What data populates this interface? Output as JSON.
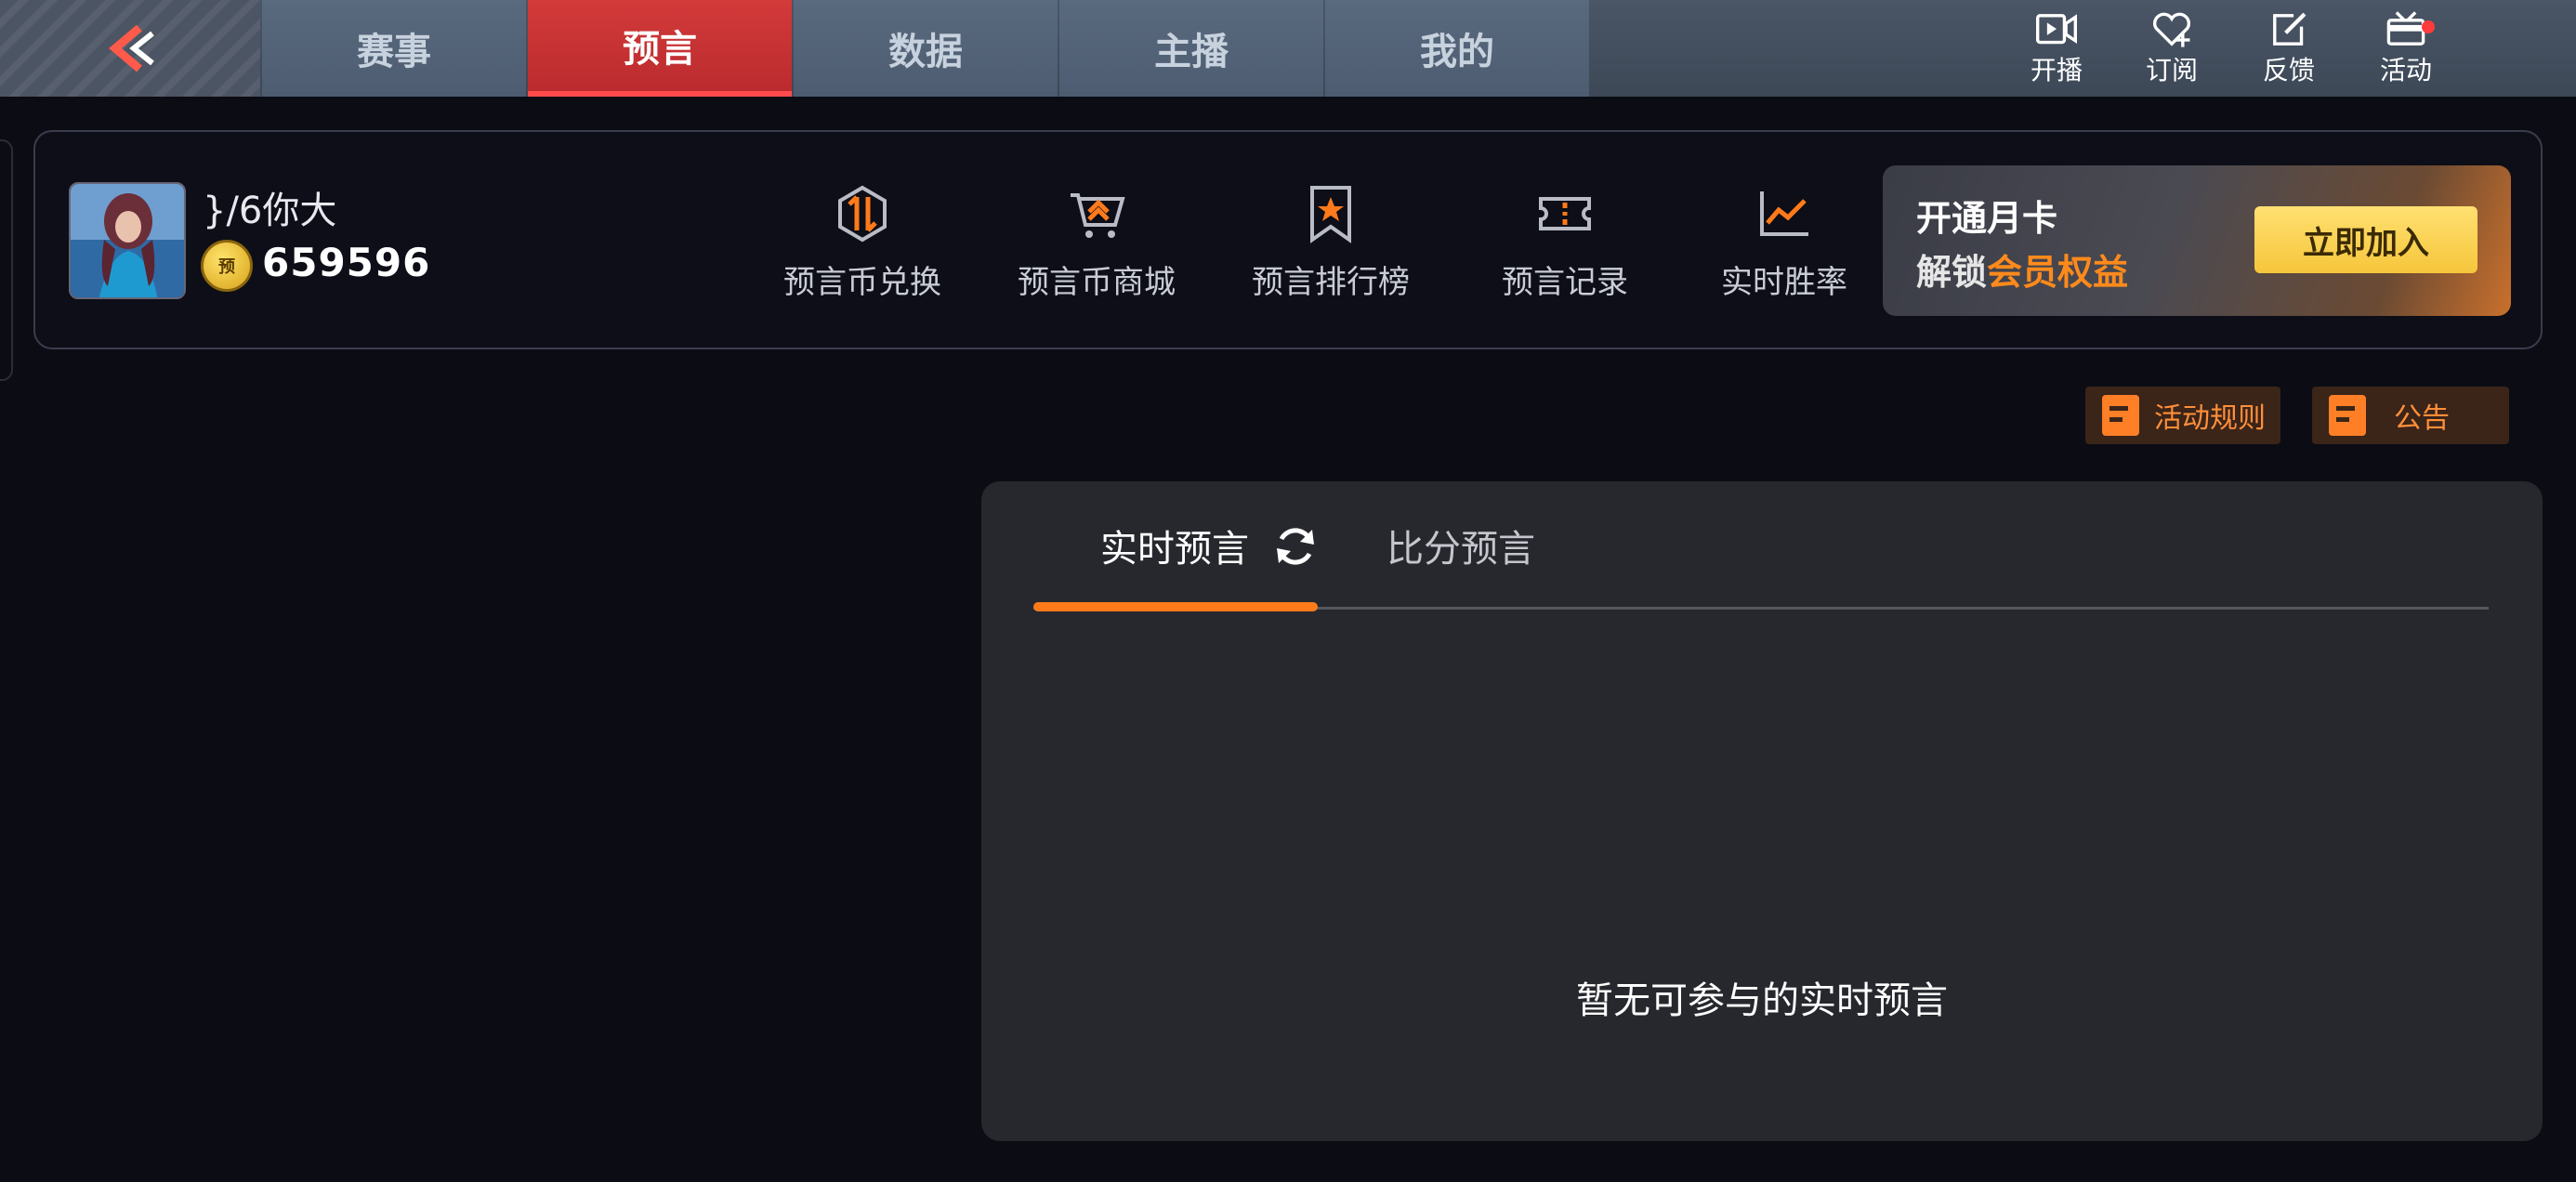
{
  "topbar": {
    "back_icon": "chevron-left-double-icon",
    "tabs": [
      {
        "label": "赛事",
        "active": false
      },
      {
        "label": "预言",
        "active": true
      },
      {
        "label": "数据",
        "active": false
      },
      {
        "label": "主播",
        "active": false
      },
      {
        "label": "我的",
        "active": false
      }
    ],
    "actions": [
      {
        "label": "开播",
        "icon": "video-play-icon"
      },
      {
        "label": "订阅",
        "icon": "heart-plus-icon"
      },
      {
        "label": "反馈",
        "icon": "edit-icon"
      },
      {
        "label": "活动",
        "icon": "tv-icon",
        "badge": true
      }
    ]
  },
  "profile": {
    "username": "}/6你大",
    "coin_badge": "预",
    "coins": "659596"
  },
  "features": [
    {
      "label": "预言币兑换",
      "icon": "exchange-icon"
    },
    {
      "label": "预言币商城",
      "icon": "shopping-cart-icon"
    },
    {
      "label": "预言排行榜",
      "icon": "ranking-bookmark-icon"
    },
    {
      "label": "预言记录",
      "icon": "ticket-icon"
    },
    {
      "label": "实时胜率",
      "icon": "line-chart-icon"
    }
  ],
  "promo": {
    "title": "开通月卡",
    "subtitle_prefix": "解锁",
    "subtitle_highlight": "会员权益",
    "button": "立即加入"
  },
  "mini_buttons": {
    "rules": "活动规则",
    "notice": "公告"
  },
  "prediction_panel": {
    "tabs": [
      {
        "label": "实时预言",
        "active": true
      },
      {
        "label": "比分预言",
        "active": false
      }
    ],
    "empty_text": "暂无可参与的实时预言"
  },
  "colors": {
    "accent_orange": "#ff7a1a",
    "active_tab_red": "#c83232",
    "background": "#0b0c14"
  }
}
